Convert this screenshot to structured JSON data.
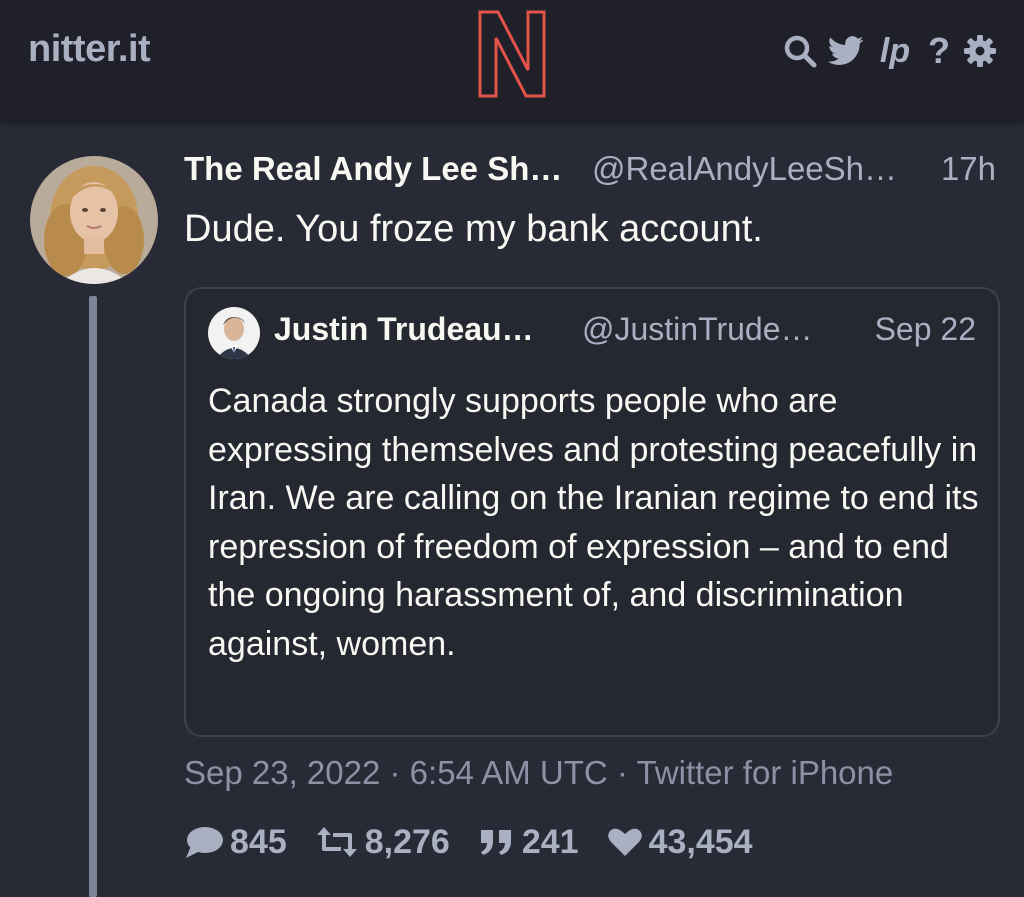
{
  "navbar": {
    "brand": "nitter.it",
    "icons": [
      "search-icon",
      "twitter-bird-icon",
      "lp-icon",
      "help-icon",
      "settings-icon"
    ],
    "help_label": "?",
    "lp_label": "lp"
  },
  "tweet": {
    "fullname": "The Real Andy Lee Sh…",
    "username": "@RealAndyLeeSh…",
    "date": "17h",
    "text": "Dude. You froze my bank account.",
    "published": "Sep 23, 2022 · 6:54 AM UTC · Twitter for iPhone",
    "stats": {
      "replies": "845",
      "retweets": "8,276",
      "quotes": "241",
      "likes": "43,454"
    }
  },
  "quote": {
    "fullname": "Justin Trudeau…",
    "username": "@JustinTrude…",
    "date": "Sep 22",
    "text": "Canada strongly supports people who are expressing themselves and protesting peacefully in Iran. We are calling on the Iranian regime to end its repression of freedom of expression – and to end the ongoing harassment of, and discrimination against, women."
  },
  "colors": {
    "background": "#282a36",
    "navbar": "#1f2029",
    "logo_accent": "#e4524a",
    "muted_text": "#a9b0c2"
  }
}
